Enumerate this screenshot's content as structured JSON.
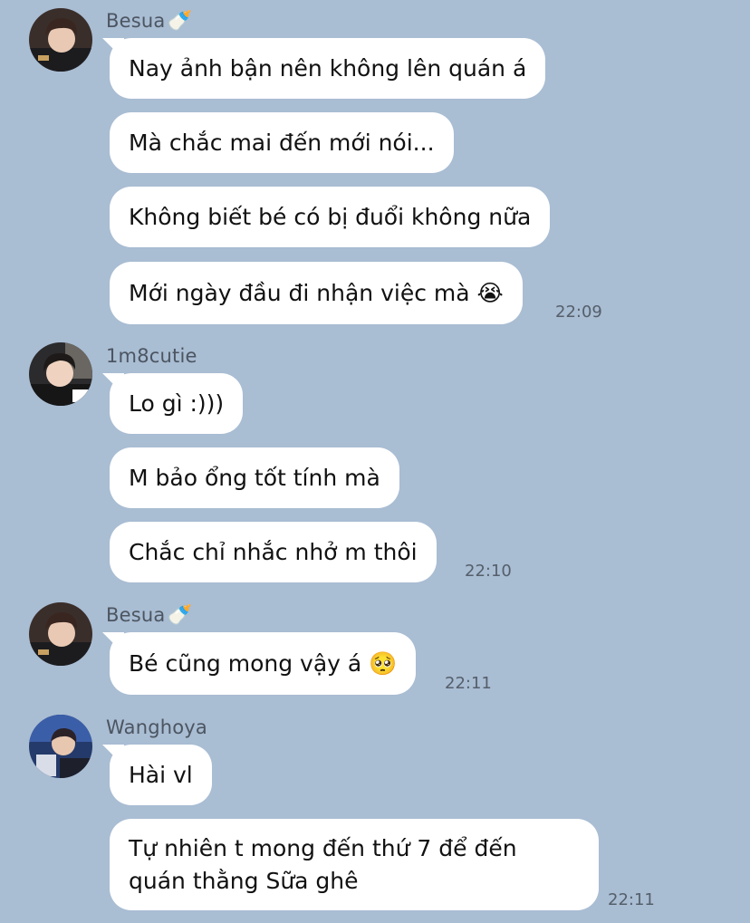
{
  "colors": {
    "background": "#a9bdd3",
    "bubble": "#ffffff",
    "time": "#555f6b"
  },
  "groups": [
    {
      "sender": "Besua",
      "sender_emoji": "🍼",
      "avatar_icon": "avatar-besua",
      "messages": [
        {
          "text": "Nay ảnh bận nên không lên quán á"
        },
        {
          "text": "Mà chắc mai đến mới nói..."
        },
        {
          "text": "Không biết bé có bị đuổi không nữa"
        },
        {
          "text": "Mới ngày đầu đi nhận việc mà 😭"
        }
      ],
      "time": "22:09"
    },
    {
      "sender": "1m8cutie",
      "avatar_icon": "avatar-1m8cutie",
      "messages": [
        {
          "text": "Lo gì :)))"
        },
        {
          "text": "M bảo ổng tốt tính mà"
        },
        {
          "text": "Chắc chỉ nhắc nhở m thôi"
        }
      ],
      "time": "22:10"
    },
    {
      "sender": "Besua",
      "sender_emoji": "🍼",
      "avatar_icon": "avatar-besua",
      "messages": [
        {
          "text": "Bé cũng mong vậy á 🥺"
        }
      ],
      "time": "22:11"
    },
    {
      "sender": "Wanghoya",
      "avatar_icon": "avatar-wanghoya",
      "messages": [
        {
          "text": "Hài vl"
        },
        {
          "text": "Tự nhiên t mong đến thứ 7 để đến quán thằng Sữa ghê"
        }
      ],
      "time": "22:11"
    }
  ]
}
